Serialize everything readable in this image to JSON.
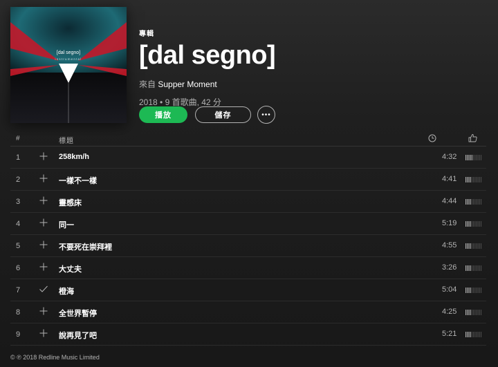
{
  "album": {
    "type_label": "專輯",
    "title": "[dal segno]",
    "by_prefix": "來自",
    "artist": "Supper Moment",
    "stats": "2018 • 9 首歌曲, 42 分",
    "cover_text": "[dal segno]",
    "cover_subtext": "instrumental"
  },
  "actions": {
    "play_label": "播放",
    "save_label": "儲存",
    "more_label": "•••"
  },
  "tracklist": {
    "header_num": "#",
    "header_title": "標題",
    "clock_icon": "clock-icon",
    "thumb_icon": "thumbs-up-icon",
    "tracks": [
      {
        "num": "1",
        "title": "258km/h",
        "duration": "4:32",
        "added": false,
        "popularity": 0.45
      },
      {
        "num": "2",
        "title": "一樣不一樣",
        "duration": "4:41",
        "added": false,
        "popularity": 0.4
      },
      {
        "num": "3",
        "title": "靈感床",
        "duration": "4:44",
        "added": false,
        "popularity": 0.4
      },
      {
        "num": "4",
        "title": "同一",
        "duration": "5:19",
        "added": false,
        "popularity": 0.35
      },
      {
        "num": "5",
        "title": "不要死在崇拜裡",
        "duration": "4:55",
        "added": false,
        "popularity": 0.4
      },
      {
        "num": "6",
        "title": "大丈夫",
        "duration": "3:26",
        "added": false,
        "popularity": 0.4
      },
      {
        "num": "7",
        "title": "橙海",
        "duration": "5:04",
        "added": true,
        "popularity": 0.35
      },
      {
        "num": "8",
        "title": "全世界暫停",
        "duration": "4:25",
        "added": false,
        "popularity": 0.35
      },
      {
        "num": "9",
        "title": "說再見了吧",
        "duration": "5:21",
        "added": false,
        "popularity": 0.35
      }
    ]
  },
  "footer": {
    "copyright": "© ℗ 2018 Redline Music Limited"
  },
  "colors": {
    "accent": "#1db954",
    "muted_text": "#b3b3b3"
  }
}
